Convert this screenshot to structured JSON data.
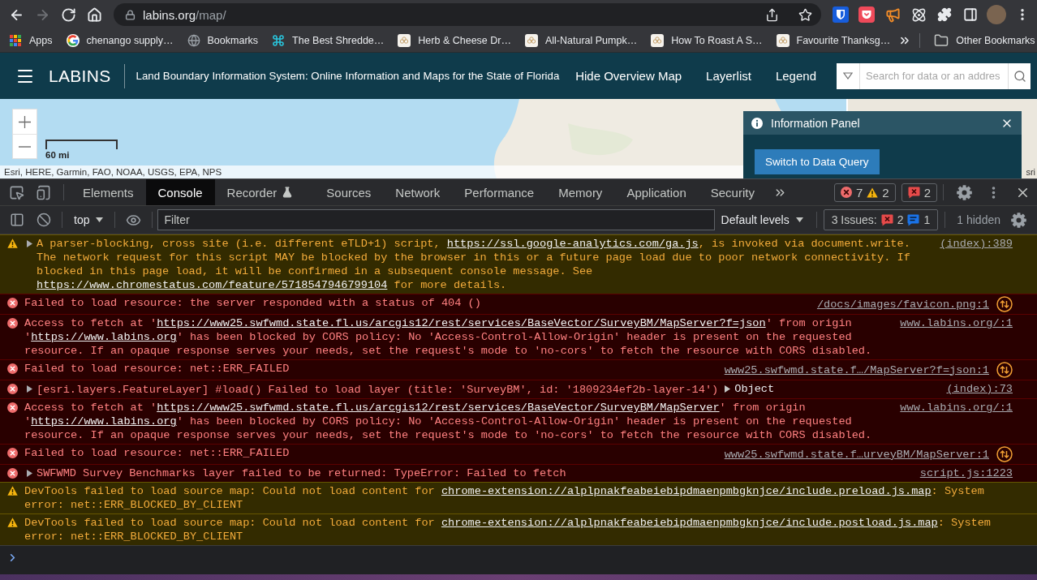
{
  "browser": {
    "nav": [
      {
        "kind": "back",
        "disabled": false
      },
      {
        "kind": "forward",
        "disabled": true
      },
      {
        "kind": "reload",
        "disabled": false
      },
      {
        "kind": "home",
        "disabled": false
      }
    ],
    "address": {
      "host": "labins.org",
      "path": "/map/"
    }
  },
  "bookmarks_bar": {
    "items": [
      {
        "kind": "apps",
        "label": "Apps"
      },
      {
        "kind": "google",
        "label": "chenango supply…"
      },
      {
        "kind": "globe",
        "label": "Bookmarks"
      },
      {
        "kind": "command",
        "label": "The Best Shredde…"
      },
      {
        "kind": "site",
        "label": "Herb & Cheese Dr…"
      },
      {
        "kind": "site",
        "label": "All-Natural Pumpk…"
      },
      {
        "kind": "site",
        "label": "How To Roast A S…"
      },
      {
        "kind": "site",
        "label": "Favourite Thanksg…"
      }
    ],
    "other": "Other Bookmarks"
  },
  "page": {
    "header": {
      "logo": "LABINS",
      "title": "Land Boundary Information System: Online Information and Maps for the State of Florida",
      "links": [
        "Hide Overview Map",
        "Layerlist",
        "Legend"
      ],
      "search": {
        "placeholder": "Search for data or an addres"
      }
    },
    "map": {
      "scale": "60 mi",
      "attribution": "Esri, HERE, Garmin, FAO, NOAA, USGS, EPA, NPS",
      "overview_attribution": "sri",
      "info_panel": {
        "title": "Information Panel",
        "button": "Switch to Data Query"
      }
    }
  },
  "devtools": {
    "tabs": [
      {
        "label": "Elements",
        "selected": false,
        "experimental": false
      },
      {
        "label": "Console",
        "selected": true,
        "experimental": false
      },
      {
        "label": "Recorder",
        "selected": false,
        "experimental": true
      },
      {
        "label": "Sources",
        "selected": false,
        "experimental": false
      },
      {
        "label": "Network",
        "selected": false,
        "experimental": false
      },
      {
        "label": "Performance",
        "selected": false,
        "experimental": false
      },
      {
        "label": "Memory",
        "selected": false,
        "experimental": false
      },
      {
        "label": "Application",
        "selected": false,
        "experimental": false
      },
      {
        "label": "Security",
        "selected": false,
        "experimental": false
      }
    ],
    "counts": {
      "errors": "7",
      "warnings": "2",
      "issues": "2"
    },
    "toolbar": {
      "context": "top",
      "filter": {
        "placeholder": "Filter"
      },
      "levels": "Default levels",
      "issues": {
        "label": "3 Issues:",
        "errors": "2",
        "infos": "1"
      },
      "hidden": "1 hidden"
    },
    "messages": [
      {
        "kind": "warning",
        "expandable": true,
        "network_link": false,
        "parts": [
          {
            "kind": "text",
            "text": "A parser-blocking, cross site (i.e. different eTLD+1) script, "
          },
          {
            "kind": "link",
            "text": "https://ssl.google-analytics.com/ga.js"
          },
          {
            "kind": "text",
            "text": ", is invoked via document.write. The network request for this script MAY be blocked by the browser in this or a future page load due to poor network connectivity. If blocked in this page load, it will be confirmed in a subsequent console message. See "
          },
          {
            "kind": "link",
            "text": "https://www.chromestatus.com/feature/5718547946799104"
          },
          {
            "kind": "text",
            "text": " for more details."
          }
        ],
        "source": "(index):389"
      },
      {
        "kind": "error",
        "expandable": false,
        "network_link": true,
        "parts": [
          {
            "kind": "text",
            "text": "Failed to load resource: the server responded with a status of 404 ()"
          }
        ],
        "source": "/docs/images/favicon.png:1"
      },
      {
        "kind": "error",
        "expandable": false,
        "network_link": false,
        "parts": [
          {
            "kind": "text",
            "text": "Access to fetch at '"
          },
          {
            "kind": "link",
            "text": "https://www25.swfwmd.state.fl.us/arcgis12/rest/services/BaseVector/SurveyBM/MapServer?f=json"
          },
          {
            "kind": "text",
            "text": "' from origin '"
          },
          {
            "kind": "link",
            "text": "https://www.labins.org"
          },
          {
            "kind": "text",
            "text": "' has been blocked by CORS policy: No 'Access-Control-Allow-Origin' header is present on the requested resource. If an opaque response serves your needs, set the request's mode to 'no-cors' to fetch the resource with CORS disabled."
          }
        ],
        "source": "www.labins.org/:1"
      },
      {
        "kind": "error",
        "expandable": false,
        "network_link": true,
        "parts": [
          {
            "kind": "text",
            "text": "Failed to load resource: net::ERR_FAILED"
          }
        ],
        "source": "www25.swfwmd.state.f…/MapServer?f=json:1"
      },
      {
        "kind": "error",
        "expandable": true,
        "network_link": false,
        "parts": [
          {
            "kind": "text",
            "text": "[esri.layers.FeatureLayer] #load() Failed to load layer (title: 'SurveyBM', id: '1809234ef2b-layer-14')"
          }
        ],
        "object": "Object",
        "source": "(index):73"
      },
      {
        "kind": "error",
        "expandable": false,
        "network_link": false,
        "parts": [
          {
            "kind": "text",
            "text": "Access to fetch at '"
          },
          {
            "kind": "link",
            "text": "https://www25.swfwmd.state.fl.us/arcgis12/rest/services/BaseVector/SurveyBM/MapServer"
          },
          {
            "kind": "text",
            "text": "' from origin '"
          },
          {
            "kind": "link",
            "text": "https://www.labins.org"
          },
          {
            "kind": "text",
            "text": "' has been blocked by CORS policy: No 'Access-Control-Allow-Origin' header is present on the requested resource. If an opaque response serves your needs, set the request's mode to 'no-cors' to fetch the resource with CORS disabled."
          }
        ],
        "source": "www.labins.org/:1"
      },
      {
        "kind": "error",
        "expandable": false,
        "network_link": true,
        "parts": [
          {
            "kind": "text",
            "text": "Failed to load resource: net::ERR_FAILED"
          }
        ],
        "source": "www25.swfwmd.state.f…urveyBM/MapServer:1"
      },
      {
        "kind": "error",
        "expandable": true,
        "network_link": false,
        "parts": [
          {
            "kind": "text",
            "text": "SWFWMD Survey Benchmarks layer failed to be returned: TypeError: Failed to fetch"
          }
        ],
        "source": "script.js:1223"
      },
      {
        "kind": "warning",
        "expandable": false,
        "network_link": false,
        "parts": [
          {
            "kind": "text",
            "text": "DevTools failed to load source map: Could not load content for "
          },
          {
            "kind": "link",
            "text": "chrome-extension://alplpnakfeabeiebipdmaenpmbgknjce/include.preload.js.map"
          },
          {
            "kind": "text",
            "text": ": System error: net::ERR_BLOCKED_BY_CLIENT"
          }
        ]
      },
      {
        "kind": "warning",
        "expandable": false,
        "network_link": false,
        "parts": [
          {
            "kind": "text",
            "text": "DevTools failed to load source map: Could not load content for "
          },
          {
            "kind": "link",
            "text": "chrome-extension://alplpnakfeabeiebipdmaenpmbgknjce/include.postload.js.map"
          },
          {
            "kind": "text",
            "text": ": System error: net::ERR_BLOCKED_BY_CLIENT"
          }
        ]
      }
    ]
  }
}
